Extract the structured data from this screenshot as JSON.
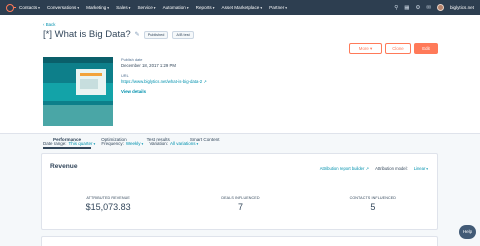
{
  "nav": {
    "items": [
      "Contacts",
      "Conversations",
      "Marketing",
      "Sales",
      "Service",
      "Automation",
      "Reports",
      "Asset Marketplace",
      "Partner"
    ],
    "account": "biglytics.net"
  },
  "header": {
    "back": "Back",
    "title": "[*] What is Big Data?",
    "badge_published": "Published",
    "badge_test": "A/B test",
    "more": "More ▾",
    "clone": "Clone",
    "edit": "Edit"
  },
  "meta": {
    "published_label": "Publish date",
    "published_value": "December 18, 2017 1:29 PM",
    "url_label": "URL",
    "url_value": "https://www.biglytics.net/what-is-big-data-2",
    "view_details": "View details"
  },
  "tabs": [
    "Performance",
    "Optimization",
    "Test results",
    "Smart Content"
  ],
  "filters": {
    "date_label": "Date range:",
    "date_value": "This quarter",
    "freq_label": "Frequency:",
    "freq_value": "Weekly",
    "var_label": "Variation:",
    "var_value": "All variations"
  },
  "revenue": {
    "title": "Revenue",
    "attribution_link": "Attribution report builder",
    "model_label": "Attribution model:",
    "model_value": "Linear",
    "stats": [
      {
        "label": "ATTRIBUTED REVENUE",
        "value": "$15,073.83"
      },
      {
        "label": "DEALS INFLUENCED",
        "value": "7"
      },
      {
        "label": "CONTACTS INFLUENCED",
        "value": "5"
      }
    ]
  },
  "help": "Help",
  "colors": {
    "nav_bg": "#2d3e50",
    "accent": "#ff7a59",
    "link": "#0091ae",
    "text": "#33475b"
  }
}
